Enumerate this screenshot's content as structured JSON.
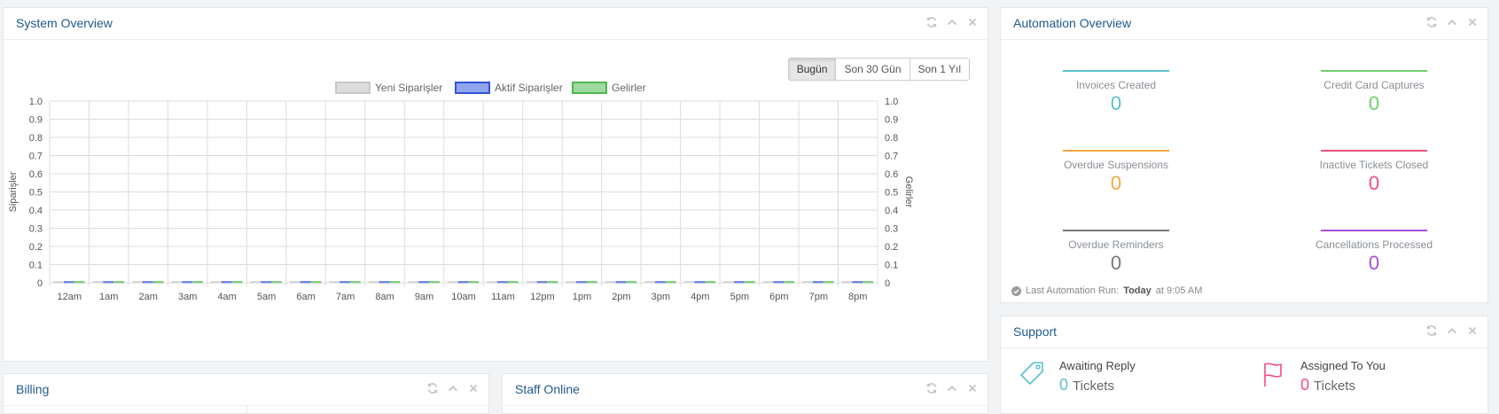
{
  "system": {
    "title": "System Overview",
    "ranges": [
      "Bugün",
      "Son 30 Gün",
      "Son 1 Yıl"
    ],
    "active_range": 0
  },
  "chart_data": {
    "type": "bar",
    "categories": [
      "12am",
      "1am",
      "2am",
      "3am",
      "4am",
      "5am",
      "6am",
      "7am",
      "8am",
      "9am",
      "10am",
      "11am",
      "12pm",
      "1pm",
      "2pm",
      "3pm",
      "4pm",
      "5pm",
      "6pm",
      "7pm",
      "8pm"
    ],
    "series": [
      {
        "name": "Yeni Siparişler",
        "values": [
          0,
          0,
          0,
          0,
          0,
          0,
          0,
          0,
          0,
          0,
          0,
          0,
          0,
          0,
          0,
          0,
          0,
          0,
          0,
          0,
          0
        ],
        "color": "#dcdcdc",
        "border": "#c8c8c8"
      },
      {
        "name": "Aktif Siparişler",
        "values": [
          0,
          0,
          0,
          0,
          0,
          0,
          0,
          0,
          0,
          0,
          0,
          0,
          0,
          0,
          0,
          0,
          0,
          0,
          0,
          0,
          0
        ],
        "color": "#8fa5f0",
        "border": "#3353d8"
      },
      {
        "name": "Gelirler",
        "values": [
          0,
          0,
          0,
          0,
          0,
          0,
          0,
          0,
          0,
          0,
          0,
          0,
          0,
          0,
          0,
          0,
          0,
          0,
          0,
          0,
          0
        ],
        "color": "#9fd99f",
        "border": "#4cb84c"
      }
    ],
    "ylabel_left": "Siparişler",
    "ylabel_right": "Gelirler",
    "ylim": [
      0,
      1
    ],
    "yticks": [
      "0",
      "0.1",
      "0.2",
      "0.3",
      "0.4",
      "0.5",
      "0.6",
      "0.7",
      "0.8",
      "0.9",
      "1.0"
    ],
    "grid": true,
    "legend": "top-center"
  },
  "automation": {
    "title": "Automation Overview",
    "stats": [
      {
        "label": "Invoices Created",
        "value": "0",
        "color": "#5bc0cc"
      },
      {
        "label": "Credit Card Captures",
        "value": "0",
        "color": "#6fcf6f"
      },
      {
        "label": "Overdue Suspensions",
        "value": "0",
        "color": "#f5a742"
      },
      {
        "label": "Inactive Tickets Closed",
        "value": "0",
        "color": "#ee4f7e"
      },
      {
        "label": "Overdue Reminders",
        "value": "0",
        "color": "#777777"
      },
      {
        "label": "Cancellations Processed",
        "value": "0",
        "color": "#a64fd8"
      }
    ],
    "last_run_label": "Last Automation Run:",
    "last_run_day": "Today",
    "last_run_time": "at 9:05 AM"
  },
  "support": {
    "title": "Support",
    "items": [
      {
        "label": "Awaiting Reply",
        "count": "0",
        "unit": "Tickets",
        "color": "#5bc0cc"
      },
      {
        "label": "Assigned To You",
        "count": "0",
        "unit": "Tickets",
        "color": "#ee4f7e"
      }
    ]
  },
  "billing": {
    "title": "Billing"
  },
  "staff": {
    "title": "Staff Online"
  }
}
